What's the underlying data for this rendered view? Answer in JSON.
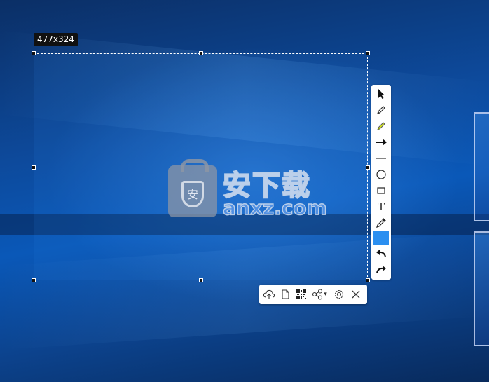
{
  "capture": {
    "size_label": "477x324"
  },
  "watermark": {
    "chinese_text": "安下载",
    "domain_text": "anxz.com",
    "shield_char": "安"
  },
  "tool_panel": {
    "tools": [
      {
        "name": "select-cursor-icon"
      },
      {
        "name": "pencil-icon"
      },
      {
        "name": "highlighter-icon"
      },
      {
        "name": "arrow-icon"
      },
      {
        "name": "line-icon"
      },
      {
        "name": "ellipse-icon"
      },
      {
        "name": "rectangle-icon"
      },
      {
        "name": "text-icon",
        "glyph": "T"
      },
      {
        "name": "eyedropper-icon"
      },
      {
        "name": "undo-icon"
      },
      {
        "name": "redo-icon"
      }
    ],
    "current_color": "#2b8ff0"
  },
  "action_bar": {
    "actions": [
      {
        "name": "cloud-upload-icon"
      },
      {
        "name": "copy-clipboard-icon"
      },
      {
        "name": "qr-code-icon"
      },
      {
        "name": "share-icon",
        "dropdown": "▾"
      },
      {
        "name": "settings-gear-icon"
      },
      {
        "name": "close-icon"
      }
    ]
  },
  "colors": {
    "accent": "#2b8ff0",
    "label_bg": "#111111",
    "toolbar_bg": "#ffffff"
  }
}
